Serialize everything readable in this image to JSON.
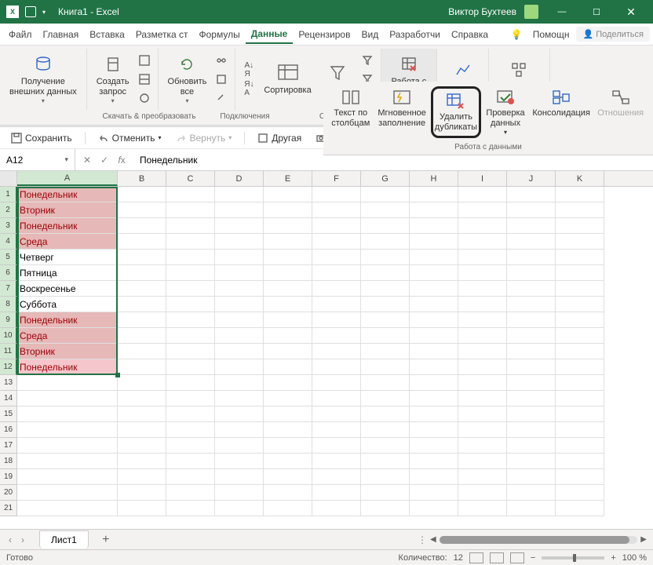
{
  "titlebar": {
    "doc_title": "Книга1 - Excel",
    "user_name": "Виктор Бухтеев"
  },
  "menu": {
    "items": [
      "Файл",
      "Главная",
      "Вставка",
      "Разметка ст",
      "Формулы",
      "Данные",
      "Рецензиров",
      "Вид",
      "Разработчи",
      "Справка"
    ],
    "active_index": 5,
    "help": "Помощн",
    "share": "Поделиться"
  },
  "ribbon": {
    "external_data": "Получение\nвнешних данных",
    "create_query": "Создать\nзапрос",
    "refresh_all": "Обновить\nвсе",
    "sort": "Сортировка",
    "filter": "Фильтр",
    "data_tools": "Работа с\nданными",
    "forecast": "Прогноз",
    "structure": "Структура",
    "group_labels": {
      "get_transform": "Скачать & преобразовать",
      "connections": "Подключения",
      "sort_filter": "Сортировка и фильтр"
    }
  },
  "data_tools_popout": {
    "text_to_columns": "Текст по\nстолбцам",
    "flash_fill": "Мгновенное\nзаполнение",
    "remove_duplicates": "Удалить\nдубликаты",
    "data_validation": "Проверка\nданных",
    "consolidate": "Консолидация",
    "relationships": "Отношения",
    "group_label": "Работа с данными"
  },
  "qat": {
    "save": "Сохранить",
    "undo": "Отменить",
    "redo": "Вернуть",
    "other": "Другая",
    "cam": "Кам"
  },
  "formula": {
    "name_box": "A12",
    "value": "Понедельник"
  },
  "sheet": {
    "columns": [
      "A",
      "B",
      "C",
      "D",
      "E",
      "F",
      "G",
      "H",
      "I",
      "J",
      "K"
    ],
    "selected_col": "A",
    "row_count": 21,
    "data": [
      {
        "v": "Понедельник",
        "dup": true
      },
      {
        "v": "Вторник",
        "dup": true
      },
      {
        "v": "Понедельник",
        "dup": true
      },
      {
        "v": "Среда",
        "dup": true
      },
      {
        "v": "Четверг",
        "dup": false
      },
      {
        "v": "Пятница",
        "dup": false
      },
      {
        "v": "Воскресенье",
        "dup": false
      },
      {
        "v": "Суббота",
        "dup": false
      },
      {
        "v": "Понедельник",
        "dup": true
      },
      {
        "v": "Среда",
        "dup": true
      },
      {
        "v": "Вторник",
        "dup": true
      },
      {
        "v": "Понедельник",
        "dup": true,
        "active": true
      }
    ],
    "tab": "Лист1"
  },
  "status": {
    "ready": "Готово",
    "count_label": "Количество:",
    "count": "12",
    "zoom": "100 %"
  }
}
